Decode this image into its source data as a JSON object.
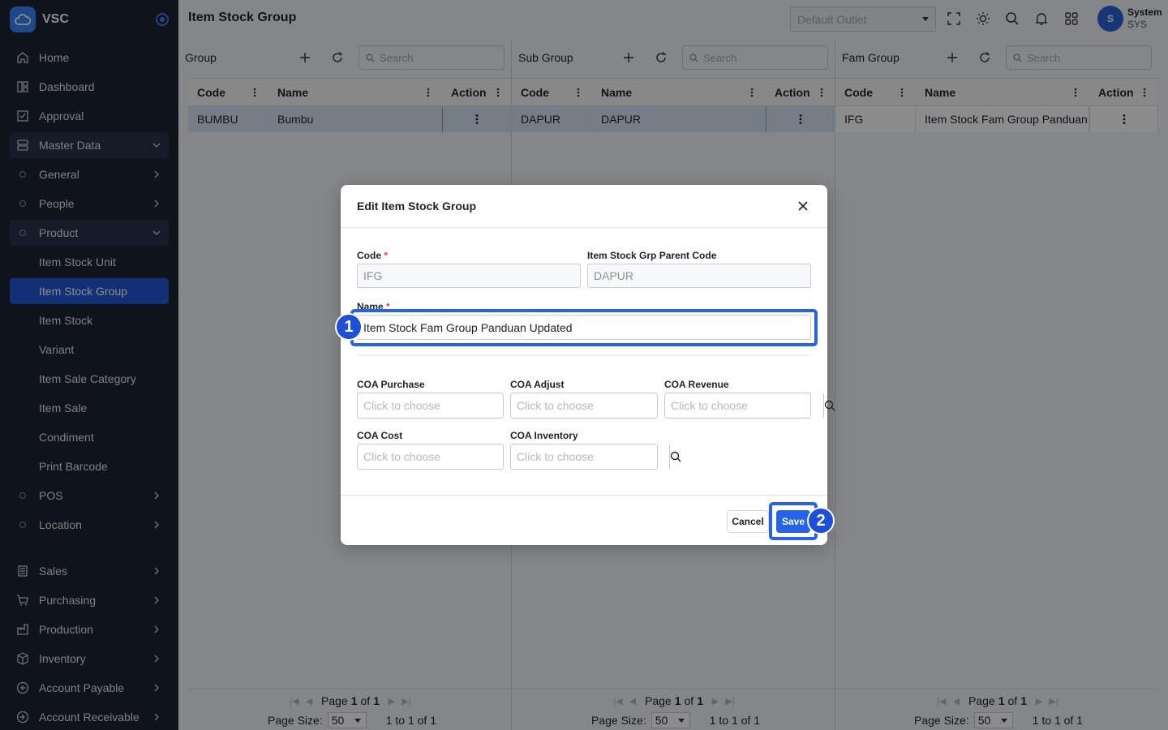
{
  "brand": {
    "name": "VSC"
  },
  "sidebar": {
    "items": [
      {
        "label": "Home",
        "icon": "home-icon"
      },
      {
        "label": "Dashboard",
        "icon": "dashboard-icon"
      },
      {
        "label": "Approval",
        "icon": "approval-icon"
      },
      {
        "label": "Master Data",
        "icon": "database-icon"
      },
      {
        "label": "General"
      },
      {
        "label": "People"
      },
      {
        "label": "Product"
      },
      {
        "label": "Item Stock Unit"
      },
      {
        "label": "Item Stock Group"
      },
      {
        "label": "Item Stock"
      },
      {
        "label": "Variant"
      },
      {
        "label": "Item Sale Category"
      },
      {
        "label": "Item Sale"
      },
      {
        "label": "Condiment"
      },
      {
        "label": "Print Barcode"
      },
      {
        "label": "POS"
      },
      {
        "label": "Location"
      },
      {
        "label": "Sales",
        "icon": "sales-icon"
      },
      {
        "label": "Purchasing",
        "icon": "cart-icon"
      },
      {
        "label": "Production",
        "icon": "production-icon"
      },
      {
        "label": "Inventory",
        "icon": "box-icon"
      },
      {
        "label": "Account Payable",
        "icon": "payable-icon"
      },
      {
        "label": "Account Receivable",
        "icon": "receivable-icon"
      }
    ]
  },
  "header": {
    "title": "Item Stock Group",
    "outlet_placeholder": "Default Outlet",
    "user_name": "System",
    "user_code": "SYS",
    "avatar_initial": "S"
  },
  "panels": [
    {
      "title": "Group",
      "search_placeholder": "Search",
      "columns": [
        "Code",
        "Name",
        "Action"
      ],
      "rows": [
        {
          "code": "BUMBU",
          "name": "Bumbu"
        }
      ],
      "pager": {
        "page_label": "Page",
        "page": "1",
        "of_label": "of",
        "total": "1",
        "page_size_label": "Page Size:",
        "page_size": "50",
        "range": "1 to 1 of 1"
      }
    },
    {
      "title": "Sub Group",
      "search_placeholder": "Search",
      "columns": [
        "Code",
        "Name",
        "Action"
      ],
      "rows": [
        {
          "code": "DAPUR",
          "name": "DAPUR"
        }
      ],
      "pager": {
        "page_label": "Page",
        "page": "1",
        "of_label": "of",
        "total": "1",
        "page_size_label": "Page Size:",
        "page_size": "50",
        "range": "1 to 1 of 1"
      }
    },
    {
      "title": "Fam Group",
      "search_placeholder": "Search",
      "columns": [
        "Code",
        "Name",
        "Action"
      ],
      "rows": [
        {
          "code": "IFG",
          "name": "Item Stock Fam Group Panduan"
        }
      ],
      "pager": {
        "page_label": "Page",
        "page": "1",
        "of_label": "of",
        "total": "1",
        "page_size_label": "Page Size:",
        "page_size": "50",
        "range": "1 to 1 of 1"
      }
    }
  ],
  "modal": {
    "title": "Edit Item Stock Group",
    "code_label": "Code",
    "code_value": "IFG",
    "parent_label": "Item Stock Grp Parent Code",
    "parent_value": "DAPUR",
    "name_label": "Name",
    "name_value": "Item Stock Fam Group Panduan Updated",
    "required_mark": "*",
    "coa_purchase_label": "COA Purchase",
    "coa_adjust_label": "COA Adjust",
    "coa_revenue_label": "COA Revenue",
    "coa_cost_label": "COA Cost",
    "coa_inventory_label": "COA Inventory",
    "coa_placeholder": "Click to choose",
    "cancel_label": "Cancel",
    "save_label": "Save"
  },
  "annotations": {
    "step1": "1",
    "step2": "2"
  },
  "colors": {
    "accent": "#2563eb",
    "sidebar_bg": "#1b2433",
    "active_item": "#2457d6"
  }
}
